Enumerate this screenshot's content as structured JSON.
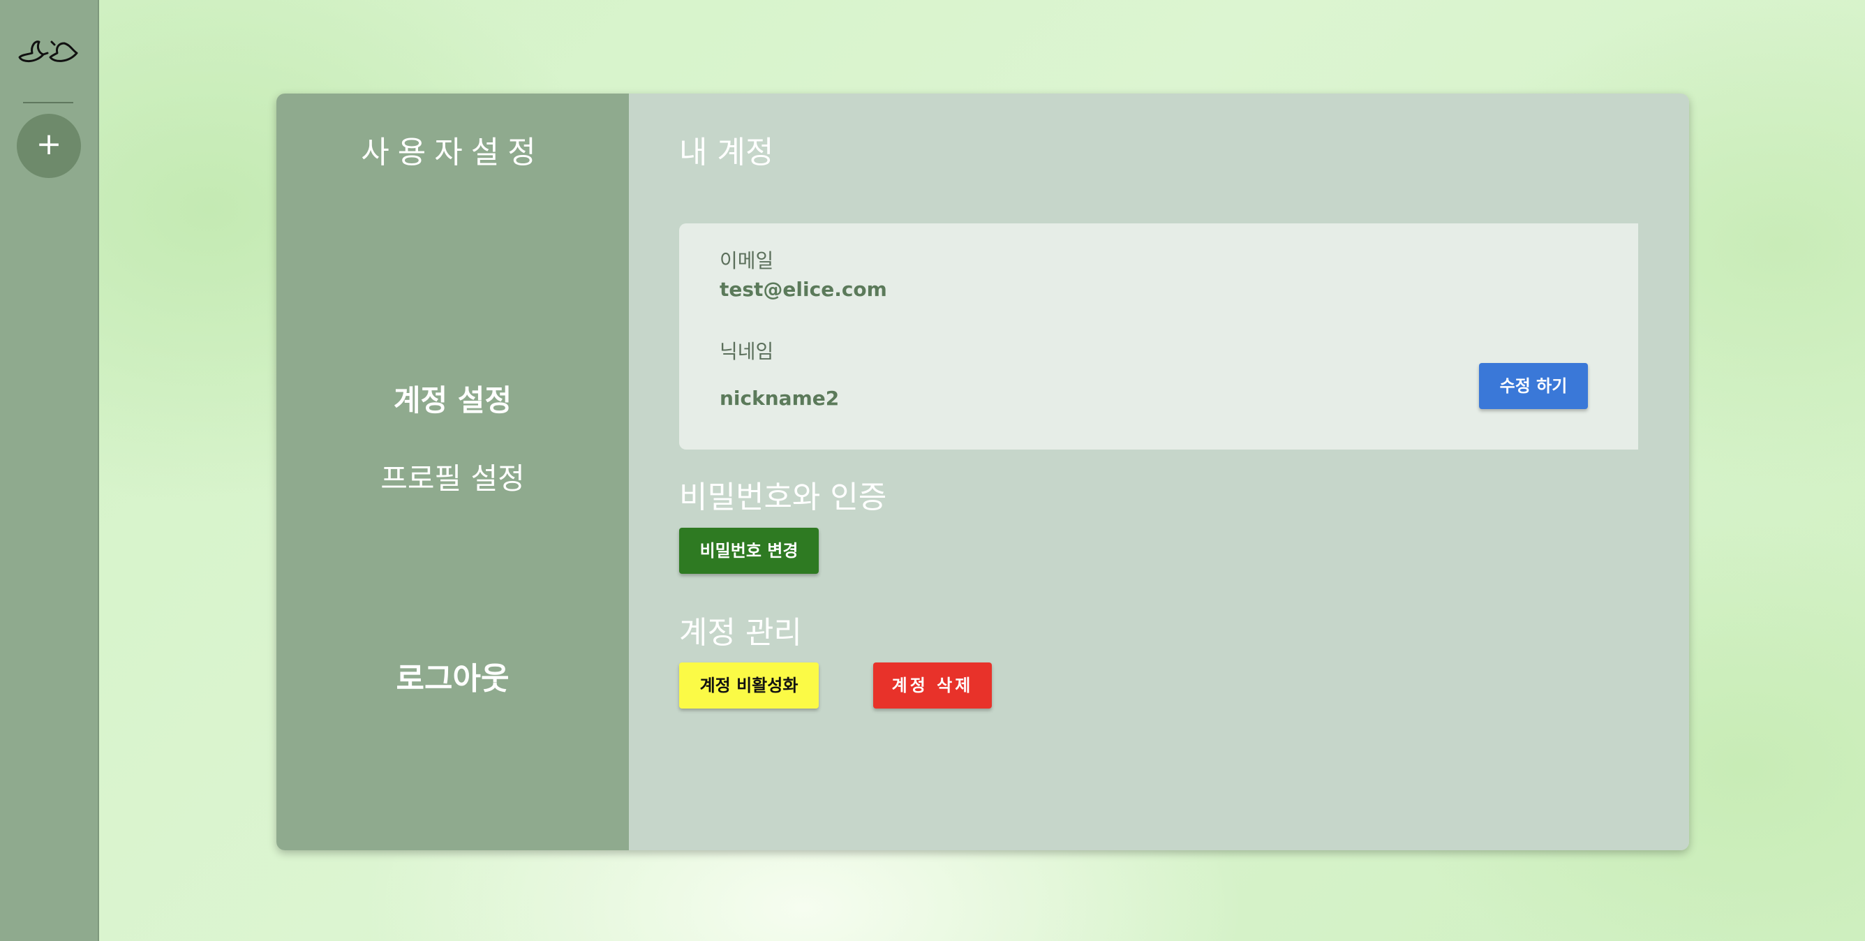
{
  "sidebar": {
    "logo_icon": "birds-logo-icon",
    "add_button_label": "+"
  },
  "settings": {
    "title": "사용자설정",
    "nav": {
      "account": "계정 설정",
      "profile": "프로필 설정",
      "logout": "로그아웃"
    }
  },
  "account": {
    "section_title": "내 계정",
    "email_label": "이메일",
    "email_value": "test@elice.com",
    "nickname_label": "닉네임",
    "nickname_value": "nickname2",
    "edit_button": "수정 하기"
  },
  "password": {
    "section_title": "비밀번호와 인증",
    "change_button": "비밀번호 변경"
  },
  "manage": {
    "section_title": "계정 관리",
    "deactivate_button": "계정 비활성화",
    "delete_button": "계정 삭제"
  },
  "colors": {
    "sidebar": "#8faa8e",
    "panel": "#c6d6ca",
    "edit_button": "#3a78d8",
    "password_button": "#2e7a22",
    "deactivate_button": "#fbfa46",
    "delete_button": "#e8322a"
  }
}
